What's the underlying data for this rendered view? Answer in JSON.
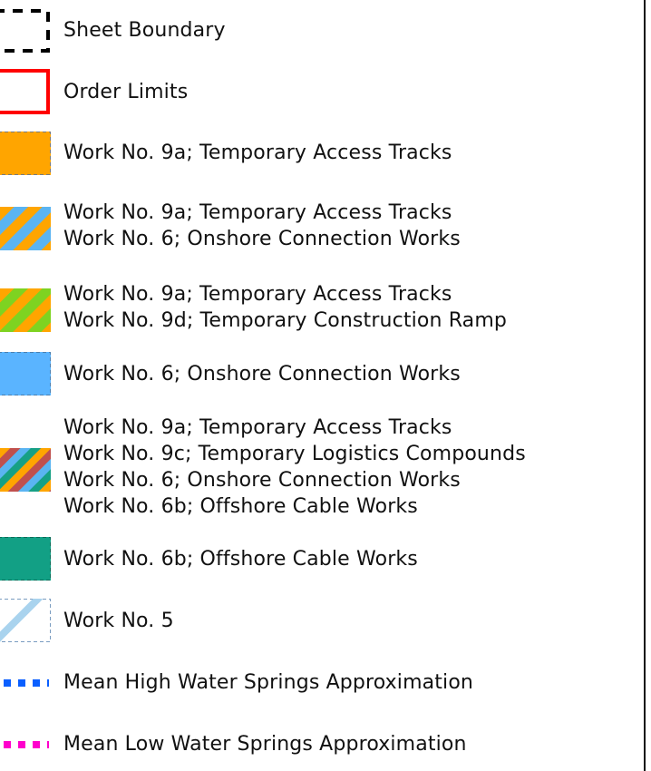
{
  "legend": {
    "items": [
      {
        "key": "sheet-boundary",
        "lines": [
          "Sheet Boundary"
        ]
      },
      {
        "key": "order-limits",
        "lines": [
          "Order Limits"
        ]
      },
      {
        "key": "work-9a",
        "lines": [
          "Work No. 9a; Temporary Access Tracks"
        ],
        "colors": [
          "#ffa500"
        ]
      },
      {
        "key": "work-9a-6",
        "lines": [
          "Work No. 9a; Temporary Access Tracks",
          "Work No. 6; Onshore Connection Works"
        ],
        "colors": [
          "#ffa500",
          "#5ab4f2"
        ]
      },
      {
        "key": "work-9a-9d",
        "lines": [
          "Work No. 9a; Temporary Access Tracks",
          "Work No. 9d; Temporary Construction Ramp"
        ],
        "colors": [
          "#ffa500",
          "#7ed321"
        ]
      },
      {
        "key": "work-6",
        "lines": [
          "Work No. 6; Onshore Connection Works"
        ],
        "colors": [
          "#5ab4ff"
        ]
      },
      {
        "key": "work-9a-9c-6-6b",
        "lines": [
          "Work No. 9a; Temporary Access Tracks",
          "Work No. 9c; Temporary Logistics Compounds",
          "Work No. 6; Onshore Connection Works",
          "Work No. 6b; Offshore Cable Works"
        ],
        "colors": [
          "#ffa500",
          "#c0504d",
          "#5ab4f2",
          "#16a085"
        ]
      },
      {
        "key": "work-6b",
        "lines": [
          "Work No. 6b; Offshore Cable Works"
        ],
        "colors": [
          "#12a085"
        ]
      },
      {
        "key": "work-5",
        "lines": [
          "Work No. 5"
        ],
        "colors": [
          "#a9d3ee"
        ]
      },
      {
        "key": "mhws",
        "lines": [
          "Mean High Water Springs Approximation"
        ],
        "colors": [
          "#0a5fff"
        ]
      },
      {
        "key": "mlws",
        "lines": [
          "Mean Low Water Springs Approximation"
        ],
        "colors": [
          "#ff00cc"
        ]
      }
    ]
  }
}
